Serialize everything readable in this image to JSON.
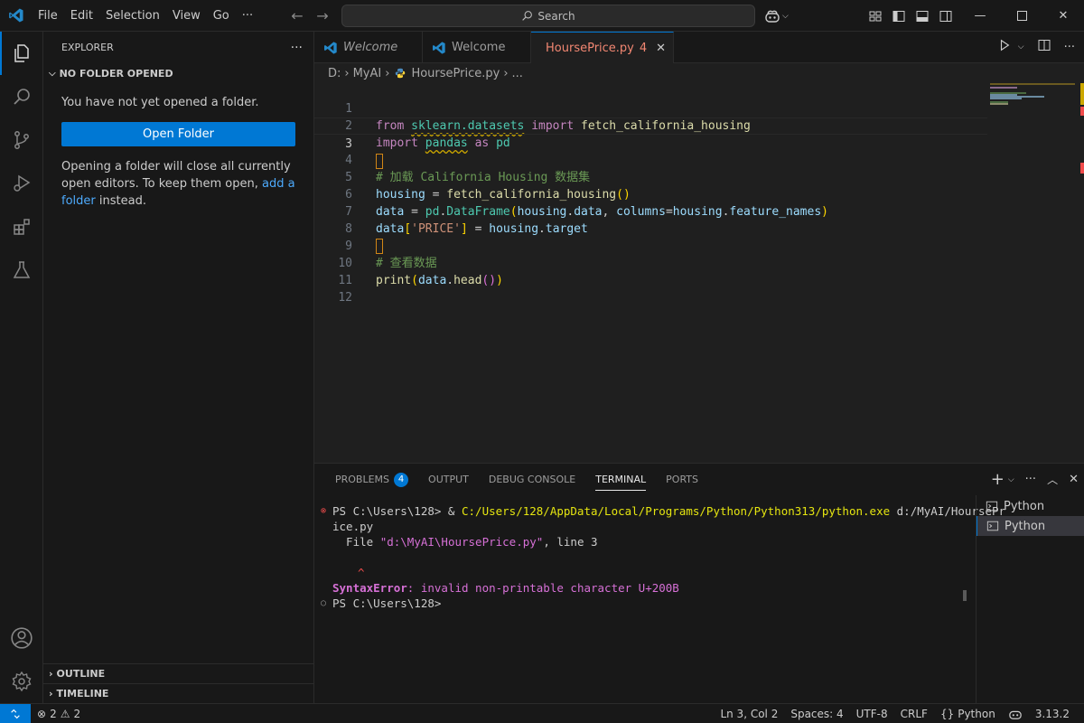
{
  "menu": [
    "File",
    "Edit",
    "Selection",
    "View",
    "Go"
  ],
  "search": {
    "placeholder": "Search"
  },
  "sidebar": {
    "title": "EXPLORER",
    "section_no_folder": "NO FOLDER OPENED",
    "msg1": "You have not yet opened a folder.",
    "open_folder_label": "Open Folder",
    "msg2_part1": "Opening a folder will close all currently open editors. To keep them open, ",
    "msg2_link": "add a folder",
    "msg2_part2": " instead.",
    "outline_label": "OUTLINE",
    "timeline_label": "TIMELINE"
  },
  "tabs": [
    {
      "label": "Welcome",
      "italic": true
    },
    {
      "label": "Welcome",
      "italic": false
    },
    {
      "label": "HoursePrice.py",
      "badge": "4",
      "active": true
    }
  ],
  "breadcrumb": {
    "drive": "D:",
    "folder": "MyAI",
    "file": "HoursePrice.py",
    "more": "..."
  },
  "editor": {
    "line_numbers": [
      "1",
      "2",
      "3",
      "4",
      "5",
      "6",
      "7",
      "8",
      "9",
      "10",
      "11",
      "12"
    ],
    "current_line": 3,
    "lines": [
      "from sklearn.datasets import fetch_california_housing",
      "import pandas as pd",
      "",
      "# 加载 California Housing 数据集",
      "housing = fetch_california_housing()",
      "data = pd.DataFrame(housing.data, columns=housing.feature_names)",
      "data['PRICE'] = housing.target",
      "",
      "# 查看数据",
      "print(data.head())",
      "",
      ""
    ]
  },
  "panel": {
    "tabs": [
      "PROBLEMS",
      "OUTPUT",
      "DEBUG CONSOLE",
      "TERMINAL",
      "PORTS"
    ],
    "problems_count": "4",
    "active_tab": "TERMINAL",
    "terminal": {
      "line1_prompt": "PS C:\\Users\\128> & ",
      "line1_path": "C:/Users/128/AppData/Local/Programs/Python/Python313/python.exe",
      "line1_arg": " d:/MyAI/HoursePr",
      "line2": "ice.py",
      "line3_pre": "  File ",
      "line3_str": "\"d:\\MyAI\\HoursePrice.py\"",
      "line3_post": ", line 3",
      "caret": "^",
      "error_type": "SyntaxError",
      "error_msg": ": invalid non-printable character U+200B",
      "prompt2": "PS C:\\Users\\128>"
    },
    "terminal_list": [
      "Python",
      "Python"
    ]
  },
  "status": {
    "errors": "2",
    "warnings": "2",
    "position": "Ln 3, Col 2",
    "spaces": "Spaces: 4",
    "encoding": "UTF-8",
    "eol": "CRLF",
    "language": "Python",
    "version": "3.13.2"
  },
  "colors": {
    "accent": "#0078d4",
    "error": "#f14c4c",
    "warning": "#cca700"
  }
}
